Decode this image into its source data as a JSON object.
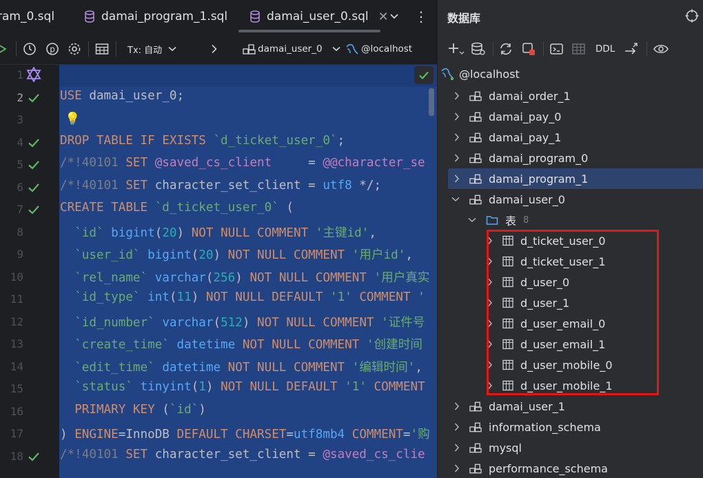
{
  "editor": {
    "tabs": [
      {
        "label": "ram_0.sql",
        "active": false
      },
      {
        "label": "damai_program_1.sql",
        "active": false
      },
      {
        "label": "damai_user_0.sql",
        "active": true
      }
    ],
    "toolbar": {
      "tx_label": "Tx: 自动",
      "schema_label": "damai_user_0",
      "datasource_label": "@localhost"
    },
    "lines": [
      {
        "n": "1",
        "check": false
      },
      {
        "n": "2",
        "check": true
      },
      {
        "n": "3",
        "check": false
      },
      {
        "n": "4",
        "check": true
      },
      {
        "n": "5",
        "check": true
      },
      {
        "n": "6",
        "check": true
      },
      {
        "n": "7",
        "check": true
      },
      {
        "n": "8",
        "check": false
      },
      {
        "n": "9",
        "check": false
      },
      {
        "n": "10",
        "check": false
      },
      {
        "n": "11",
        "check": false
      },
      {
        "n": "12",
        "check": false
      },
      {
        "n": "13",
        "check": false
      },
      {
        "n": "14",
        "check": false
      },
      {
        "n": "15",
        "check": false
      },
      {
        "n": "16",
        "check": false
      },
      {
        "n": "17",
        "check": false
      },
      {
        "n": "18",
        "check": true
      }
    ],
    "code": [
      "",
      "USE damai_user_0;",
      "",
      "DROP TABLE IF EXISTS `d_ticket_user_0`;",
      "/*!40101 SET @saved_cs_client     = @@character_se",
      "/*!40101 SET character_set_client = utf8 */;",
      "CREATE TABLE `d_ticket_user_0` (",
      "  `id` bigint(20) NOT NULL COMMENT '主键id',",
      "  `user_id` bigint(20) NOT NULL COMMENT '用户id',",
      "  `rel_name` varchar(256) NOT NULL COMMENT '用户真实",
      "  `id_type` int(11) NOT NULL DEFAULT '1' COMMENT '",
      "  `id_number` varchar(512) NOT NULL COMMENT '证件号",
      "  `create_time` datetime NOT NULL COMMENT '创建时间",
      "  `edit_time` datetime NOT NULL COMMENT '编辑时间',",
      "  `status` tinyint(1) NOT NULL DEFAULT '1' COMMENT",
      "  PRIMARY KEY (`id`)",
      ") ENGINE=InnoDB DEFAULT CHARSET=utf8mb4 COMMENT='购",
      "/*!40101 SET character_set_client = @saved_cs_clie"
    ]
  },
  "database_panel": {
    "title": "数据库",
    "toolbar": {
      "ddl_label": "DDL"
    },
    "root": "@localhost",
    "nodes": [
      {
        "label": "damai_order_1",
        "type": "schema",
        "expanded": false,
        "selected": false
      },
      {
        "label": "damai_pay_0",
        "type": "schema",
        "expanded": false,
        "selected": false
      },
      {
        "label": "damai_pay_1",
        "type": "schema",
        "expanded": false,
        "selected": false
      },
      {
        "label": "damai_program_0",
        "type": "schema",
        "expanded": false,
        "selected": false
      },
      {
        "label": "damai_program_1",
        "type": "schema",
        "expanded": false,
        "selected": true
      },
      {
        "label": "damai_user_0",
        "type": "schema",
        "expanded": true,
        "selected": false
      },
      {
        "label": "表",
        "type": "folder",
        "expanded": true,
        "count": "8"
      },
      {
        "label": "d_ticket_user_0",
        "type": "table"
      },
      {
        "label": "d_ticket_user_1",
        "type": "table"
      },
      {
        "label": "d_user_0",
        "type": "table"
      },
      {
        "label": "d_user_1",
        "type": "table"
      },
      {
        "label": "d_user_email_0",
        "type": "table"
      },
      {
        "label": "d_user_email_1",
        "type": "table"
      },
      {
        "label": "d_user_mobile_0",
        "type": "table"
      },
      {
        "label": "d_user_mobile_1",
        "type": "table"
      },
      {
        "label": "damai_user_1",
        "type": "schema",
        "expanded": false,
        "selected": false
      },
      {
        "label": "information_schema",
        "type": "schema",
        "expanded": false,
        "selected": false
      },
      {
        "label": "mysql",
        "type": "schema",
        "expanded": false,
        "selected": false
      },
      {
        "label": "performance_schema",
        "type": "schema",
        "expanded": false,
        "selected": false
      }
    ]
  },
  "colors": {
    "selection": "#214283",
    "keyword": "#cf8e6d",
    "string": "#6aab73",
    "number": "#2aacb8",
    "function": "#56a8f5",
    "check": "#5fb865",
    "highlight_box": "#e01818"
  }
}
